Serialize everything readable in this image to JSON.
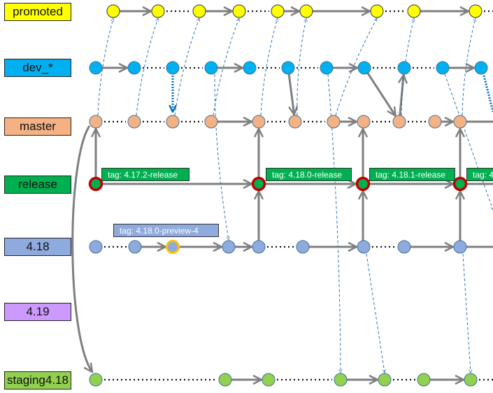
{
  "branches": [
    {
      "id": "promoted",
      "label": "promoted",
      "color": "#ffff00"
    },
    {
      "id": "dev",
      "label": "dev_*",
      "color": "#00b0f0"
    },
    {
      "id": "master",
      "label": "master",
      "color": "#f4b183"
    },
    {
      "id": "release",
      "label": "release",
      "color": "#00b050"
    },
    {
      "id": "r418",
      "label": "4.18",
      "color": "#8faadc"
    },
    {
      "id": "r419",
      "label": "4.19",
      "color": "#cc99ff"
    },
    {
      "id": "staging",
      "label": "staging4.18",
      "color": "#92d050"
    }
  ],
  "tags": {
    "t1": "tag: 4.17.2-release",
    "t2": "tag: 4.18.0-release",
    "t3": "tag: 4.18.1-release",
    "t4": "tag: 4.",
    "t5": "tag: 4.18.0-preview-4"
  },
  "colors": {
    "arrow": "#7f7f7f",
    "merge_dashed": "#2e75b6",
    "release_ring": "#c00000",
    "preview_ring": "#ffc000",
    "release_tag": "#00b050",
    "preview_tag": "#8faadc"
  }
}
